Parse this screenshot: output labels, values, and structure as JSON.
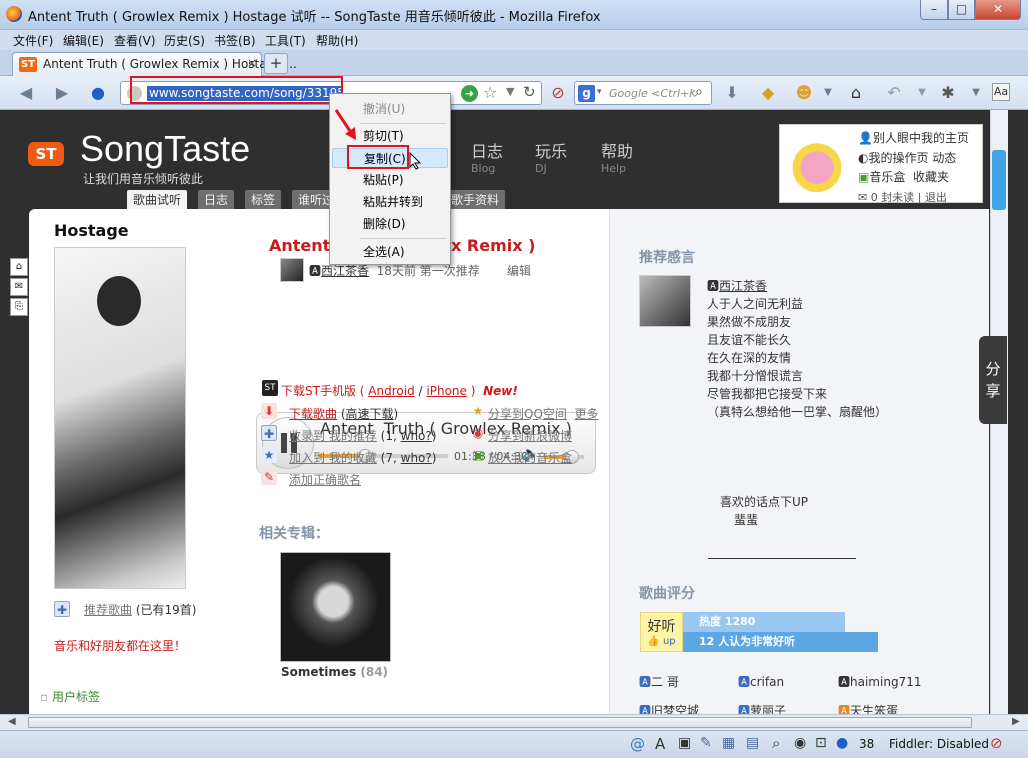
{
  "window": {
    "title": "Antent Truth ( Growlex Remix ) Hostage 试听 -- SongTaste 用音乐倾听彼此 - Mozilla Firefox",
    "btn_minimize": "–",
    "btn_maximize": "□",
    "btn_close": "✕"
  },
  "menubar": {
    "items": [
      "文件(F)",
      "编辑(E)",
      "查看(V)",
      "历史(S)",
      "书签(B)",
      "工具(T)",
      "帮助(H)"
    ]
  },
  "tabs": {
    "active_label": "Antent Truth ( Growlex Remix ) Hostage ...",
    "close": "×",
    "new_tab": "+"
  },
  "navbar": {
    "url": "www.songtaste.com/song/3319594/",
    "search_engine": "g",
    "search_placeholder": "Google <Ctrl+K>"
  },
  "context_menu": {
    "undo": "撤消(U)",
    "cut": "剪切(T)",
    "copy": "复制(C)",
    "paste": "粘贴(P)",
    "paste_go": "粘贴并转到",
    "delete": "删除(D)",
    "select_all": "全选(A)"
  },
  "site": {
    "logo_badge": "ST",
    "logo_text": "SongTaste",
    "slogan": "让我们用音乐倾听彼此",
    "nav": [
      {
        "main": "日志",
        "sub": "Blog"
      },
      {
        "main": "玩乐",
        "sub": "DJ"
      },
      {
        "main": "帮助",
        "sub": "Help"
      }
    ],
    "tabs": [
      "歌曲试听",
      "日志",
      "标签",
      "谁听过",
      "歌手资料"
    ],
    "user": {
      "link1": "别人眼中我的主页",
      "link2": "我的操作页",
      "link3": "动态",
      "link4": "音乐盒",
      "link5": "收藏夹",
      "unread": "0 封未读",
      "logout": "退出",
      "sep": "|"
    }
  },
  "song": {
    "album_heading": "Hostage",
    "title": "Antent Truth ( Growlex Remix )",
    "title_partial_left": "Antent",
    "title_partial_right": "x Remix )",
    "recommender": "西江茶香",
    "recommend_time": "18天前 第一次推荐",
    "edit": "编辑",
    "player_title": "Antent  Truth ( Growlex Remix )",
    "time": "01:38 / 04:30",
    "progress": 0.363,
    "volume": 0.7
  },
  "actions": {
    "mobile_prefix": "下载ST手机版",
    "android": "Android",
    "iphone": "iPhone",
    "paren_open": "(",
    "paren_close": ")",
    "slash": "/",
    "new_badge": "New!",
    "download": "下载歌曲",
    "hq_download": "高速下载",
    "recommend": "收录到 我的推荐",
    "recommend_count": "(1,",
    "who1": "who?",
    "fav": "加入到 我的收藏",
    "fav_count": "(7,",
    "who2": "who?",
    "close_paren": ")",
    "correct": "添加正确歌名",
    "qq": "分享到QQ空间",
    "more": "更多",
    "weibo": "分享到新浪微博",
    "musicbox": "放入我的音乐盒"
  },
  "left_panel": {
    "rec_link": "推荐歌曲",
    "rec_count": "(已有19首)",
    "promo": "音乐和好朋友都在这里！",
    "user_tags": "用户标签"
  },
  "album": {
    "heading": "相关专辑：",
    "name": "Sometimes",
    "count": "(84)"
  },
  "right": {
    "rec_heading": "推荐感言",
    "rec_user": "西江茶香",
    "lines": [
      "人于人之间无利益",
      "果然做不成朋友",
      "且友谊不能长久",
      "在久在深的友情",
      "我都十分憎恨谎言",
      "尽管我都把它接受下来",
      "（真特么想给他一巴掌、扇醒他）"
    ],
    "tail1": "喜欢的话点下UP",
    "tail2": "蜚蜚",
    "rating_heading": "歌曲评分",
    "rating_good": "好听",
    "rating_up": "up",
    "heat": "热度 1280",
    "likes": "12 人认为非常好听",
    "heat_fraction": 0.55,
    "likes_fraction": 0.66,
    "users_row1": [
      "二 哥",
      "crifan",
      "haiming711"
    ],
    "users_row2": [
      "旧梦空城",
      "萝丽子",
      "天生笨蛋"
    ]
  },
  "share_tab": "分享",
  "statusbar": {
    "count": "38",
    "fiddler": "Fiddler: Disabled"
  },
  "colors": {
    "brand": "#ef5a14",
    "title_red": "#c81c1c",
    "link_blue": "#1a4aa0",
    "highlight": "#3165c5",
    "annotation_red": "#e1141a"
  }
}
